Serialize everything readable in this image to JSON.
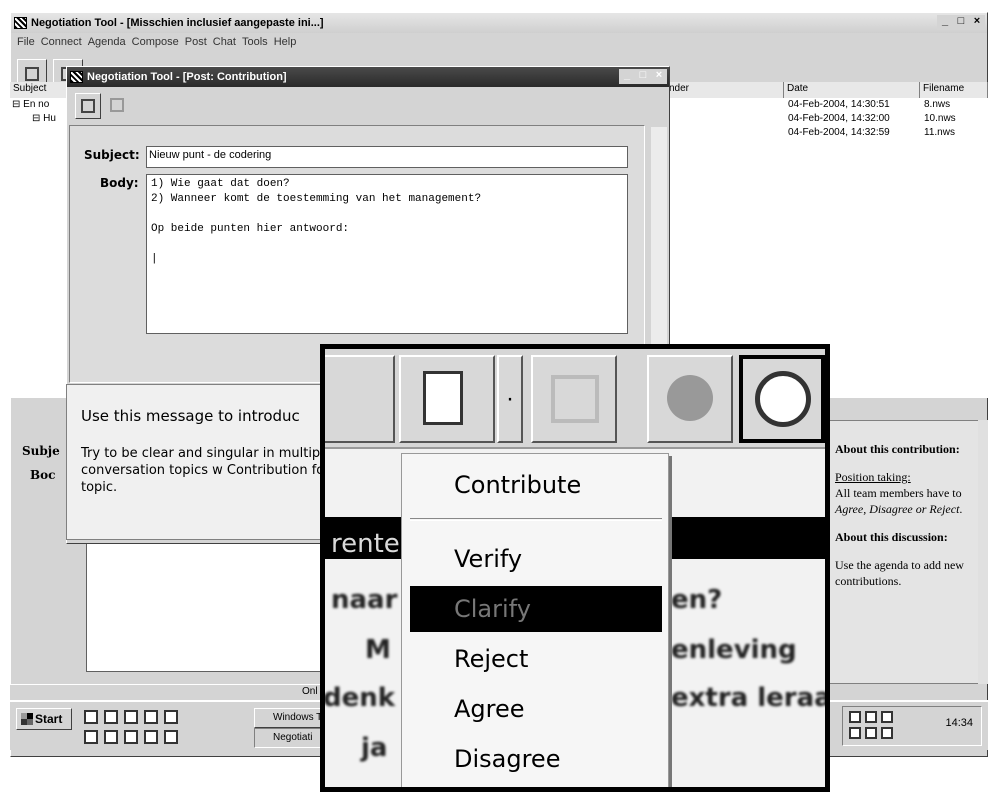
{
  "main_window": {
    "title": "Negotiation Tool - [Misschien inclusief aangepaste ini...]",
    "menu": [
      "File",
      "Connect",
      "Agenda",
      "Compose",
      "Post",
      "Chat",
      "Tools",
      "Help"
    ],
    "window_controls": [
      "_",
      "□",
      "×"
    ]
  },
  "list": {
    "columns": [
      "Subject",
      "nder",
      "Date",
      "Filename"
    ],
    "tree": [
      "En no",
      "Hu"
    ],
    "rows": [
      {
        "date": "04-Feb-2004, 14:30:51",
        "filename": "8.nws"
      },
      {
        "date": "04-Feb-2004, 14:32:00",
        "filename": "10.nws"
      },
      {
        "date": "04-Feb-2004, 14:32:59",
        "filename": "11.nws"
      }
    ]
  },
  "post_window": {
    "title": "Negotiation Tool - [Post: Contribution]",
    "window_controls": [
      "_",
      "□",
      "×"
    ],
    "subject_label": "Subject:",
    "subject_value": "Nieuw punt - de codering",
    "body_label": "Body:",
    "body_value": "1) Wie gaat dat doen?\n2) Wanneer komt de toestemming van het management?\n\nOp beide punten hier antwoord:\n\n|"
  },
  "tip": {
    "heading": "Use this message to introduc",
    "text": "Try to be clear and singular in multiple conversation topics w Contribution for each topic."
  },
  "lower": {
    "subject_label": "Subje",
    "body_label": "Boc"
  },
  "about": {
    "heading1": "About this contribution:",
    "link": "Position taking:",
    "text1_pre": "All team members have to ",
    "text1_em": "Agree, Disagree or Reject",
    "text1_post": ".",
    "heading2": "About this discussion:",
    "text2": "Use the agenda to add new contributions."
  },
  "status": {
    "text": "Onl"
  },
  "taskbar": {
    "start": "Start",
    "items": [
      "Windows T",
      "Negotiati"
    ],
    "clock": "14:34"
  },
  "zoom": {
    "menu_items": [
      "Contribute",
      "Verify",
      "Clarify",
      "Reject",
      "Agree",
      "Disagree"
    ],
    "selected": "Clarify",
    "background_fragments": [
      "rente",
      "naar",
      "en?",
      "M",
      "enleving",
      "denk",
      "extra leraa",
      "ja"
    ]
  }
}
